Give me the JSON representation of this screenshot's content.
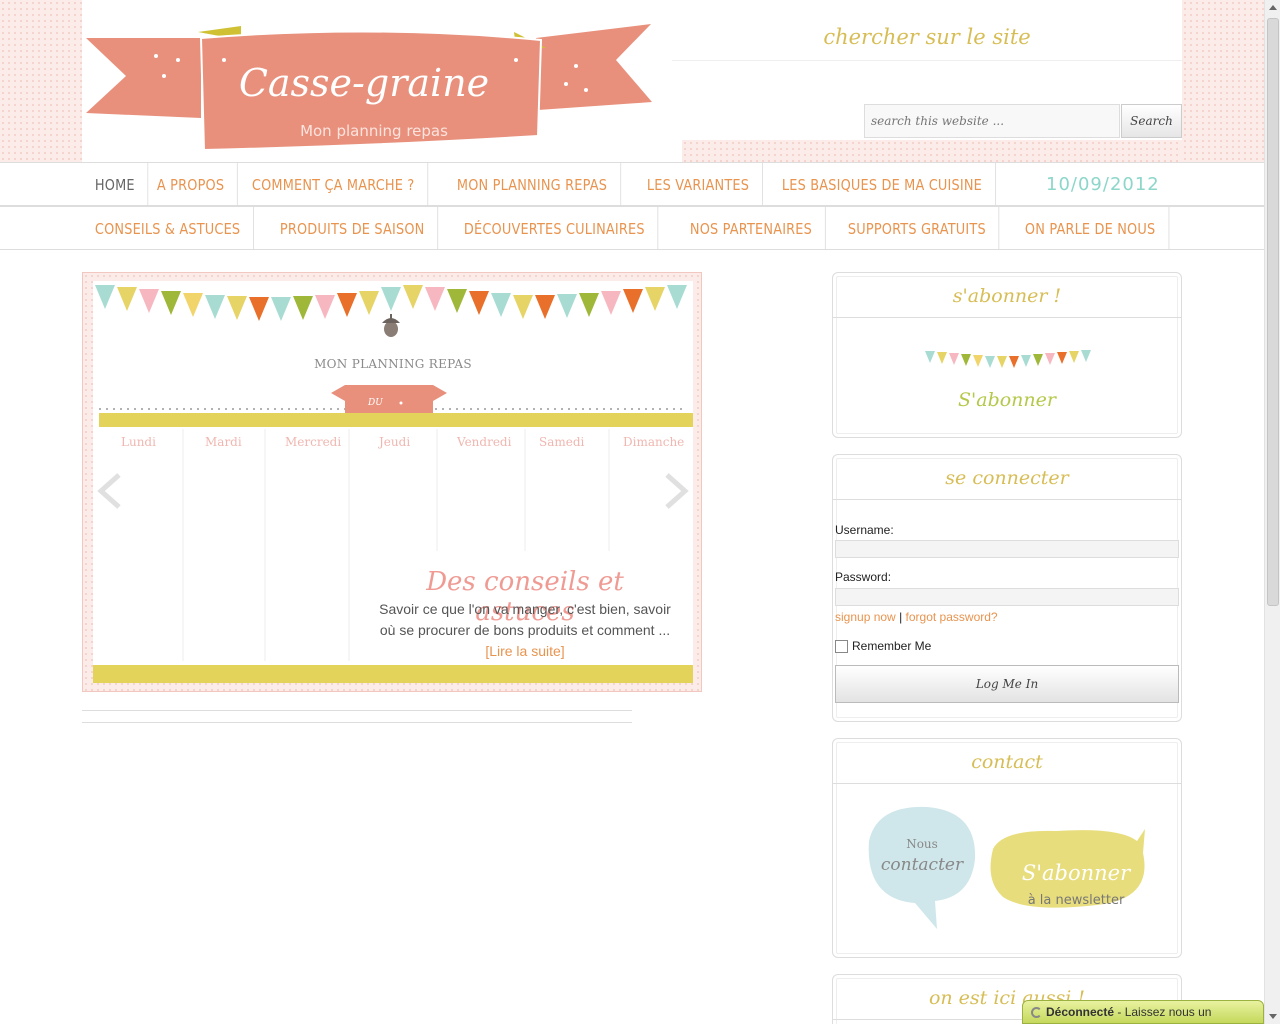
{
  "header": {
    "logo_title": "Casse-graine",
    "logo_subtitle": "Mon planning repas",
    "search_title": "chercher sur le site",
    "search_placeholder": "search this website ...",
    "search_button": "Search"
  },
  "nav_primary": [
    "HOME",
    "A PROPOS",
    "COMMENT ÇA MARCHE ?",
    "MON PLANNING REPAS",
    "LES VARIANTES",
    "LES BASIQUES DE MA CUISINE"
  ],
  "nav_date": "10/09/2012",
  "nav_secondary": [
    "CONSEILS & ASTUCES",
    "PRODUITS DE SAISON",
    "DÉCOUVERTES CULINAIRES",
    "NOS PARTENAIRES",
    "SUPPORTS GRATUITS",
    "ON PARLE DE NOUS"
  ],
  "slider": {
    "planning_label": "MON PLANNING REPAS",
    "ribbon_text": "DU",
    "days": [
      "Lundi",
      "Mardi",
      "Mercredi",
      "Jeudi",
      "Vendredi",
      "Samedi",
      "Dimanche"
    ],
    "title": "Des conseils et astuces",
    "text": "Savoir ce que l'on va manger, c'est bien, savoir où se procurer de bons produits et comment ...",
    "more": "[Lire la suite]"
  },
  "widgets": {
    "subscribe": {
      "title": "s'abonner !",
      "link": "S'abonner"
    },
    "login": {
      "title": "se connecter",
      "username_label": "Username:",
      "password_label": "Password:",
      "signup": "signup now",
      "separator": "|",
      "forgot": "forgot password?",
      "remember": "Remember Me",
      "button": "Log Me In"
    },
    "contact": {
      "title": "contact",
      "bubble1_line1": "Nous",
      "bubble1_line2": "contacter",
      "bubble2_line1": "S'abonner",
      "bubble2_line2": "à la newsletter"
    },
    "also": {
      "title": "on est ici aussi !"
    }
  },
  "status_bar": {
    "label": "Déconnecté",
    "text": " - Laissez nous un"
  },
  "colors": {
    "coral": "#e8907c",
    "mustard": "#d7bd55",
    "orange": "#e8944f",
    "mint": "#8cd6ca",
    "pink": "#ef9b94"
  }
}
